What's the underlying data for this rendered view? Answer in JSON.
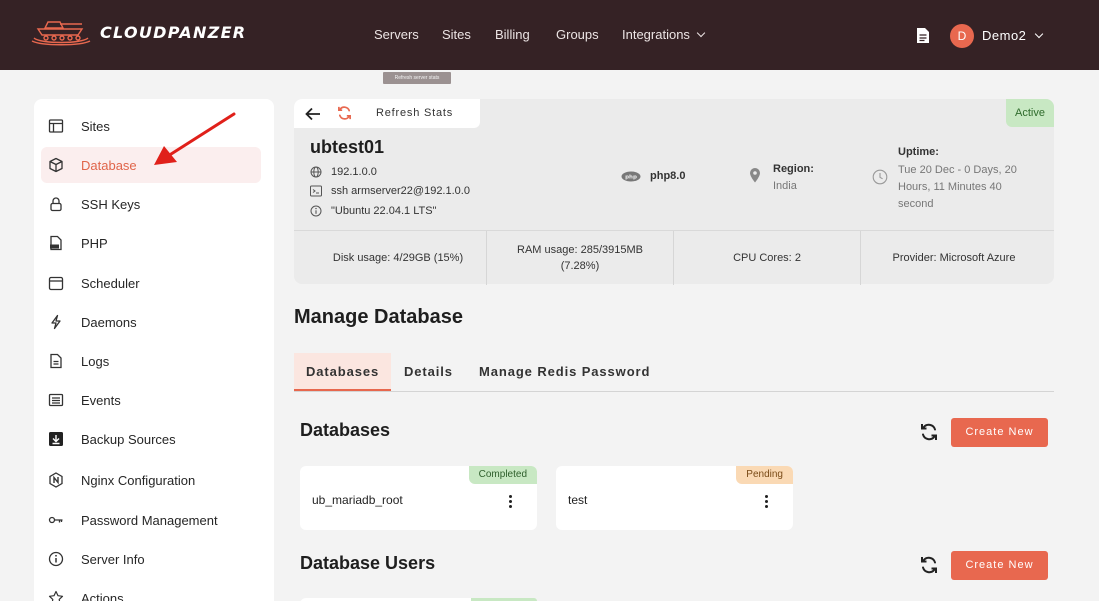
{
  "app": {
    "brand": "CLOUDPANZER"
  },
  "nav": {
    "servers": "Servers",
    "sites": "Sites",
    "billing": "Billing",
    "groups": "Groups",
    "integrations": "Integrations"
  },
  "user": {
    "initial": "D",
    "name": "Demo2"
  },
  "tooltip": "Refresh server stats",
  "sidebar": {
    "items": [
      {
        "label": "Sites",
        "icon": "layout-icon"
      },
      {
        "label": "Database",
        "icon": "cube-icon"
      },
      {
        "label": "SSH Keys",
        "icon": "lock-icon"
      },
      {
        "label": "PHP",
        "icon": "php-file-icon"
      },
      {
        "label": "Scheduler",
        "icon": "calendar-icon"
      },
      {
        "label": "Daemons",
        "icon": "bolt-icon"
      },
      {
        "label": "Logs",
        "icon": "file-icon"
      },
      {
        "label": "Events",
        "icon": "list-icon"
      },
      {
        "label": "Backup Sources",
        "icon": "download-icon"
      },
      {
        "label": "Nginx Configuration",
        "icon": "nginx-icon"
      },
      {
        "label": "Password Management",
        "icon": "key-icon"
      },
      {
        "label": "Server Info",
        "icon": "info-icon"
      },
      {
        "label": "Actions",
        "icon": "star-icon"
      }
    ]
  },
  "server": {
    "refresh_label": "Refresh Stats",
    "status": "Active",
    "name": "ubtest01",
    "ip": "192.1.0.0",
    "ssh": "ssh armserver22@192.1.0.0",
    "os": "\"Ubuntu 22.04.1 LTS\"",
    "php": "php8.0",
    "region_label": "Region:",
    "region": "India",
    "uptime_label": "Uptime:",
    "uptime_line1": "Tue 20 Dec - 0 Days, 20",
    "uptime_line2": "Hours, 11 Minutes 40",
    "uptime_line3": "second"
  },
  "stats": {
    "disk_label": "Disk usage:",
    "disk": "4/29GB (15%)",
    "ram_label": "RAM usage:",
    "ram": "285/3915MB",
    "ram_pct": "(7.28%)",
    "cpu_label": "CPU Cores:",
    "cpu": "2",
    "provider_label": "Provider:",
    "provider": "Microsoft Azure"
  },
  "page": {
    "title": "Manage Database"
  },
  "tabs": [
    "Databases",
    "Details",
    "Manage Redis Password"
  ],
  "databases": {
    "title": "Databases",
    "create_label": "Create New",
    "items": [
      {
        "name": "ub_mariadb_root",
        "status": "Completed"
      },
      {
        "name": "test",
        "status": "Pending"
      }
    ]
  },
  "db_users": {
    "title": "Database Users",
    "create_label": "Create New"
  },
  "colors": {
    "accent": "#e8684f",
    "topbar": "#352225",
    "completed": "#c8e8c3",
    "pending": "#fad9b4"
  }
}
